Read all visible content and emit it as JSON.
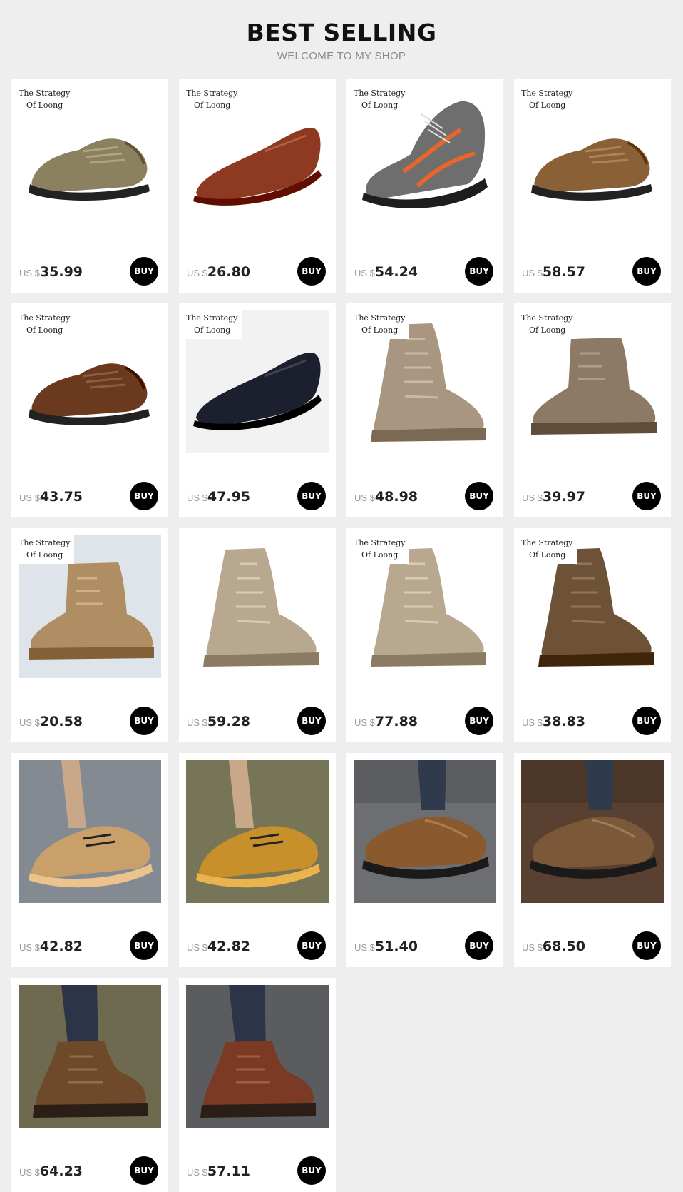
{
  "header": {
    "title": "BEST SELLING",
    "subtitle": "WELCOME TO MY SHOP"
  },
  "currency_label": "US $",
  "buy_label": "BUY",
  "brand": {
    "line1": "The Strategy",
    "line2": "Of Loong"
  },
  "products": [
    {
      "price": "35.99",
      "branded": true,
      "image": "low-shoe",
      "bg": "#ffffff",
      "shoe": "#8b8060"
    },
    {
      "price": "26.80",
      "branded": true,
      "image": "slip-on-loafer",
      "bg": "#ffffff",
      "shoe": "#8e3a22"
    },
    {
      "price": "54.24",
      "branded": true,
      "image": "sport-hiking-shoe",
      "bg": "#ffffff",
      "shoe": "#6e6e6e"
    },
    {
      "price": "58.57",
      "branded": true,
      "image": "low-shoe",
      "bg": "#ffffff",
      "shoe": "#8a6036"
    },
    {
      "price": "43.75",
      "branded": true,
      "image": "low-shoe",
      "bg": "#ffffff",
      "shoe": "#6b3a1e"
    },
    {
      "price": "47.95",
      "branded": true,
      "image": "slip-on-loafer",
      "bg": "#f2f2f2",
      "shoe": "#1c1f2e"
    },
    {
      "price": "48.98",
      "branded": true,
      "image": "tall-boot",
      "bg": "#ffffff",
      "shoe": "#a89680"
    },
    {
      "price": "39.97",
      "branded": true,
      "image": "ankle-boot",
      "bg": "#ffffff",
      "shoe": "#8c7a66"
    },
    {
      "price": "20.58",
      "branded": true,
      "image": "ankle-boot",
      "bg": "#dfe4ea",
      "shoe": "#b08e64"
    },
    {
      "price": "59.28",
      "branded": false,
      "image": "tall-boot",
      "bg": "#ffffff",
      "shoe": "#b9a890"
    },
    {
      "price": "77.88",
      "branded": true,
      "image": "tall-boot",
      "bg": "#ffffff",
      "shoe": "#b9a890"
    },
    {
      "price": "38.83",
      "branded": true,
      "image": "tall-boot",
      "bg": "#ffffff",
      "shoe": "#6e5238"
    },
    {
      "price": "42.82",
      "branded": false,
      "image": "lifestyle-sneaker",
      "bg": "#7a8088",
      "shoe": "#c9a06a"
    },
    {
      "price": "42.82",
      "branded": false,
      "image": "lifestyle-sneaker",
      "bg": "#6b6a4a",
      "shoe": "#c8902a"
    },
    {
      "price": "51.40",
      "branded": false,
      "image": "lifestyle-shoe",
      "bg": "#6d6e72",
      "shoe": "#8a5a2e"
    },
    {
      "price": "68.50",
      "branded": false,
      "image": "lifestyle-shoe",
      "bg": "#5a4030",
      "shoe": "#7a5838"
    },
    {
      "price": "64.23",
      "branded": false,
      "image": "lifestyle-boot",
      "bg": "#6e6a50",
      "shoe": "#6e4a2a"
    },
    {
      "price": "57.11",
      "branded": false,
      "image": "lifestyle-boot",
      "bg": "#5a5c60",
      "shoe": "#7a3a24"
    }
  ]
}
